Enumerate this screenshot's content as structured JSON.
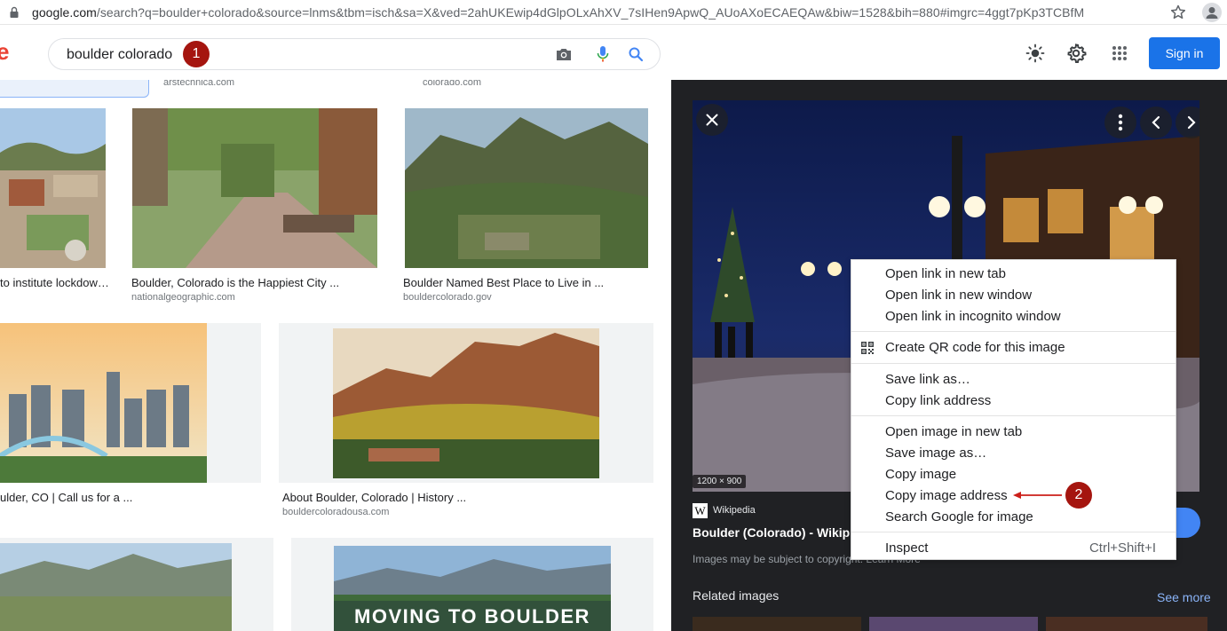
{
  "browser": {
    "url_host": "google.com",
    "url_rest": "/search?q=boulder+colorado&source=lnms&tbm=isch&sa=X&ved=2ahUKEwip4dGlpOLxAhXV_7sIHen9ApwQ_AUoAXoECAEQAw&biw=1528&bih=880#imgrc=4ggt7pKp3TCBfM"
  },
  "search": {
    "query": "boulder colorado",
    "step_badge": "1"
  },
  "header": {
    "signin_label": "Sign in"
  },
  "results": {
    "top_sites": [
      "arstechnica.com",
      "colorado.com"
    ],
    "row1": [
      {
        "title": "to institute lockdow…",
        "site": ""
      },
      {
        "title": "Boulder, Colorado is the Happiest City ...",
        "site": "nationalgeographic.com"
      },
      {
        "title": "Boulder Named Best Place to Live in ...",
        "site": "bouldercolorado.gov"
      }
    ],
    "row2": [
      {
        "title": "ulder, CO | Call us for a ...",
        "site": ""
      },
      {
        "title": "About Boulder, Colorado | History ...",
        "site": "bouldercoloradousa.com"
      }
    ],
    "row3_overlay": "MOVING TO BOULDER"
  },
  "panel": {
    "dimensions": "1200 × 900",
    "source": "Wikipedia",
    "title": "Boulder (Colorado) - Wikip",
    "copyright": "Images may be subject to copyright. Learn More",
    "related_label": "Related images",
    "see_more": "See more"
  },
  "context_menu": {
    "items": [
      {
        "label": "Open link in new tab"
      },
      {
        "label": "Open link in new window"
      },
      {
        "label": "Open link in incognito window"
      },
      {
        "label": "Create QR code for this image"
      },
      {
        "label": "Save link as…"
      },
      {
        "label": "Copy link address"
      },
      {
        "label": "Open image in new tab"
      },
      {
        "label": "Save image as…"
      },
      {
        "label": "Copy image"
      },
      {
        "label": "Copy image address"
      },
      {
        "label": "Search Google for image"
      },
      {
        "label": "Inspect",
        "shortcut": "Ctrl+Shift+I"
      }
    ],
    "step_badge": "2"
  },
  "colors": {
    "accent": "#1a73e8",
    "badge": "#a5150f",
    "panel_bg": "#202124"
  }
}
